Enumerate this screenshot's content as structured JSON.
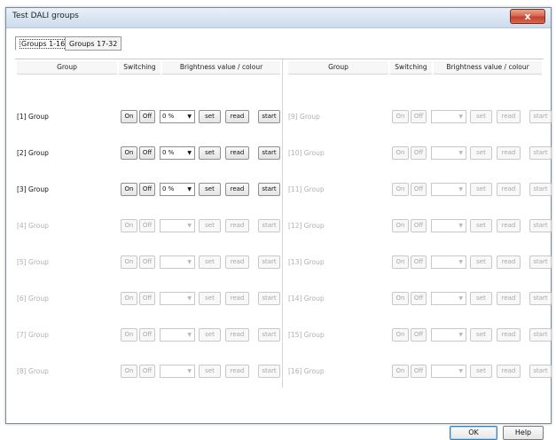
{
  "window": {
    "title": "Test DALI groups",
    "close_glyph": "x"
  },
  "tabs": [
    {
      "label": "Groups 1-16",
      "active": true
    },
    {
      "label": "Groups 17-32",
      "active": false
    }
  ],
  "headers": {
    "group": "Group",
    "switching": "Switching",
    "brightness": "Brightness value / colour"
  },
  "buttons": {
    "on": "On",
    "off": "Off",
    "set": "set",
    "read": "read",
    "start": "start"
  },
  "left_groups": [
    {
      "label": "[1] Group",
      "enabled": true,
      "value": "0 %"
    },
    {
      "label": "[2] Group",
      "enabled": true,
      "value": "0 %"
    },
    {
      "label": "[3] Group",
      "enabled": true,
      "value": "0 %"
    },
    {
      "label": "[4] Group",
      "enabled": false,
      "value": ""
    },
    {
      "label": "[5] Group",
      "enabled": false,
      "value": ""
    },
    {
      "label": "[6] Group",
      "enabled": false,
      "value": ""
    },
    {
      "label": "[7] Group",
      "enabled": false,
      "value": ""
    },
    {
      "label": "[8] Group",
      "enabled": false,
      "value": ""
    }
  ],
  "right_groups": [
    {
      "label": "[9] Group",
      "enabled": false,
      "value": ""
    },
    {
      "label": "[10] Group",
      "enabled": false,
      "value": ""
    },
    {
      "label": "[11] Group",
      "enabled": false,
      "value": ""
    },
    {
      "label": "[12] Group",
      "enabled": false,
      "value": ""
    },
    {
      "label": "[13] Group",
      "enabled": false,
      "value": ""
    },
    {
      "label": "[14] Group",
      "enabled": false,
      "value": ""
    },
    {
      "label": "[15] Group",
      "enabled": false,
      "value": ""
    },
    {
      "label": "[16] Group",
      "enabled": false,
      "value": ""
    }
  ],
  "footer": {
    "ok": "OK",
    "help": "Help"
  },
  "icons": {
    "dropdown": "chevron-down-icon",
    "close": "close-icon"
  },
  "colors": {
    "title_gradient": "#d9e5f2",
    "close_button": "#c4402a",
    "disabled_text": "#b0b0b0"
  }
}
